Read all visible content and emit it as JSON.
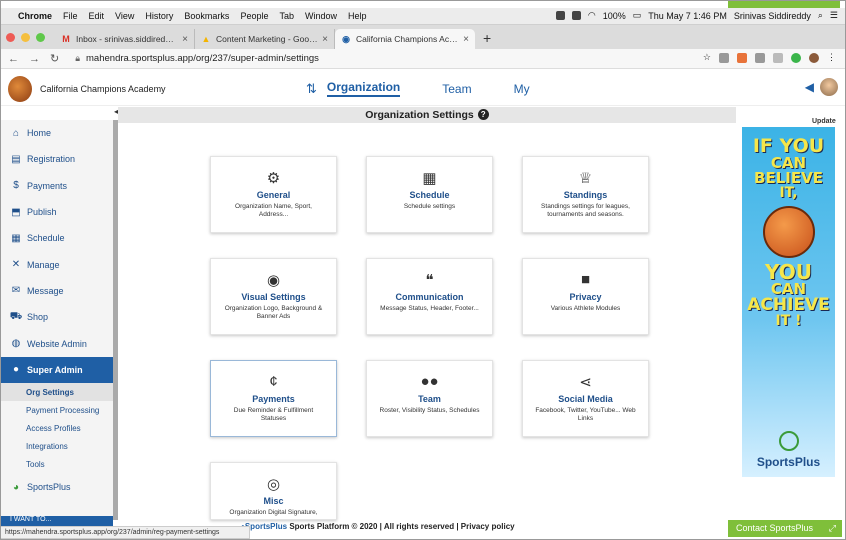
{
  "mac_menu": {
    "app": "Chrome",
    "items": [
      "File",
      "Edit",
      "View",
      "History",
      "Bookmarks",
      "People",
      "Tab",
      "Window",
      "Help"
    ],
    "battery": "100%",
    "clock": "Thu May 7  1:46 PM",
    "user": "Srinivas Siddireddy"
  },
  "tabs": [
    {
      "label": "Inbox - srinivas.siddireddy@th"
    },
    {
      "label": "Content Marketing - Google D"
    },
    {
      "label": "California Champions Academ"
    }
  ],
  "address": {
    "url": "mahendra.sportsplus.app/org/237/super-admin/settings"
  },
  "header": {
    "org_name": "California Champions Academy",
    "nav": [
      "Organization",
      "Team",
      "My"
    ]
  },
  "sidebar": {
    "items": [
      "Home",
      "Registration",
      "Payments",
      "Publish",
      "Schedule",
      "Manage",
      "Message",
      "Shop",
      "Website Admin"
    ],
    "active": "Super Admin",
    "subitems": [
      "Org Settings",
      "Payment Processing",
      "Access Profiles",
      "Integrations",
      "Tools"
    ],
    "sportsplus": "SportsPlus",
    "bottom": "I WANT TO..."
  },
  "main": {
    "title": "Organization Settings",
    "cards": [
      {
        "title": "General",
        "desc": "Organization Name, Sport, Address...",
        "icon": "gear-icon"
      },
      {
        "title": "Schedule",
        "desc": "Schedule settings",
        "icon": "calendar-icon"
      },
      {
        "title": "Standings",
        "desc": "Standings settings for leagues, tournaments and seasons.",
        "icon": "trophy-icon"
      },
      {
        "title": "Visual Settings",
        "desc": "Organization Logo, Background & Banner Ads",
        "icon": "eye-icon"
      },
      {
        "title": "Communication",
        "desc": "Message Status, Header, Footer...",
        "icon": "chat-icon"
      },
      {
        "title": "Privacy",
        "desc": "Various Athlete Modules",
        "icon": "lock-icon"
      },
      {
        "title": "Payments",
        "desc": "Due Reminder & Fulfillment Statuses",
        "icon": "cent-icon"
      },
      {
        "title": "Team",
        "desc": "Roster, Visibility Status, Schedules",
        "icon": "users-icon"
      },
      {
        "title": "Social Media",
        "desc": "Facebook, Twitter, YouTube... Web Links",
        "icon": "share-icon"
      },
      {
        "title": "Misc",
        "desc": "Organization Digital Signature,",
        "icon": "disc-icon"
      }
    ]
  },
  "ad": {
    "update": "Update",
    "lines": [
      "IF YOU",
      "CAN",
      "BELIEVE",
      "IT,",
      "YOU",
      "CAN",
      "ACHIEVE",
      "IT !"
    ],
    "brand": "SportsPlus"
  },
  "footer": {
    "text": "Sports Platform © 2020 | All rights reserved | Privacy policy",
    "brand": "SportsPlus",
    "status_url": "https://mahendra.sportsplus.app/org/237/admin/reg-payment-settings",
    "contact": "Contact SportsPlus"
  }
}
